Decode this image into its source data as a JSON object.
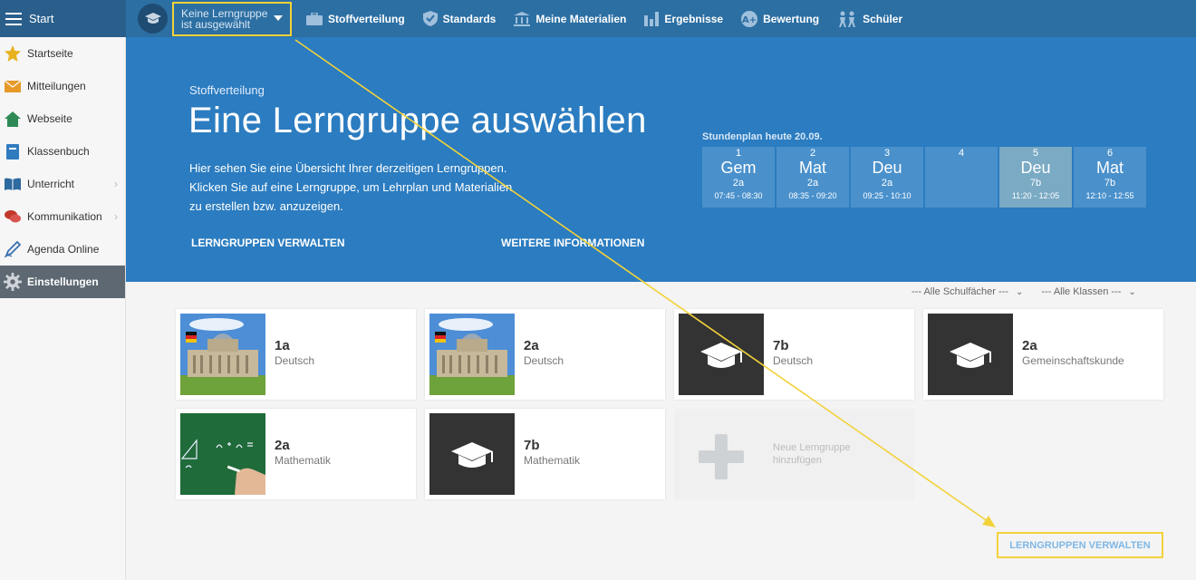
{
  "topbar": {
    "start_label": "Start",
    "group_select": {
      "line1": "Keine Lerngruppe",
      "line2": "ist ausgewählt"
    },
    "nav": [
      {
        "label": "Stoffverteilung",
        "icon": "briefcase-icon"
      },
      {
        "label": "Standards",
        "icon": "shield-icon"
      },
      {
        "label": "Meine Materialien",
        "icon": "library-icon"
      },
      {
        "label": "Ergebnisse",
        "icon": "bar-chart-icon"
      },
      {
        "label": "Bewertung",
        "icon": "grading-icon"
      },
      {
        "label": "Schüler",
        "icon": "students-icon"
      }
    ]
  },
  "sidebar": {
    "items": [
      {
        "label": "Startseite",
        "icon": "star-icon"
      },
      {
        "label": "Mitteilungen",
        "icon": "envelope-icon"
      },
      {
        "label": "Webseite",
        "icon": "home-icon"
      },
      {
        "label": "Klassenbuch",
        "icon": "notebook-icon"
      },
      {
        "label": "Unterricht",
        "icon": "book-icon"
      },
      {
        "label": "Kommunikation",
        "icon": "chat-icon"
      },
      {
        "label": "Agenda Online",
        "icon": "pen-icon"
      },
      {
        "label": "Einstellungen",
        "icon": "gear-icon"
      }
    ]
  },
  "hero": {
    "kicker": "Stoffverteilung",
    "title": "Eine Lerngruppe auswählen",
    "desc1": "Hier sehen Sie eine Übersicht Ihrer derzeitigen Lerngruppen.",
    "desc2": "Klicken Sie auf eine Lerngruppe, um Lehrplan und Materialien",
    "desc3": "zu erstellen bzw. anzuzeigen.",
    "link_manage": "LERNGRUPPEN VERWALTEN",
    "link_info": "WEITERE INFORMATIONEN"
  },
  "schedule": {
    "title": "Stundenplan heute 20.09.",
    "slots": [
      {
        "num": "1",
        "subject": "Gem",
        "class": "2a",
        "time": "07:45 - 08:30"
      },
      {
        "num": "2",
        "subject": "Mat",
        "class": "2a",
        "time": "08:35 - 09:20"
      },
      {
        "num": "3",
        "subject": "Deu",
        "class": "2a",
        "time": "09:25 - 10:10"
      },
      {
        "num": "4",
        "subject": "",
        "class": "",
        "time": ""
      },
      {
        "num": "5",
        "subject": "Deu",
        "class": "7b",
        "time": "11:20 - 12:05"
      },
      {
        "num": "6",
        "subject": "Mat",
        "class": "7b",
        "time": "12:10 - 12:55"
      }
    ]
  },
  "filters": {
    "subjects": "--- Alle Schulfächer ---",
    "classes": "--- Alle Klassen ---"
  },
  "cards": [
    {
      "class": "1a",
      "subject": "Deutsch"
    },
    {
      "class": "2a",
      "subject": "Deutsch"
    },
    {
      "class": "7b",
      "subject": "Deutsch"
    },
    {
      "class": "2a",
      "subject": "Gemeinschaftskunde"
    },
    {
      "class": "2a",
      "subject": "Mathematik"
    },
    {
      "class": "7b",
      "subject": "Mathematik"
    }
  ],
  "add_card": {
    "line1": "Neue Lerngruppe",
    "line2": "hinzufügen"
  },
  "bottom_link": "LERNGRUPPEN VERWALTEN",
  "colors": {
    "topbar": "#2c6fa3",
    "hero": "#2b7cc0",
    "highlight": "#f2d23a",
    "active_sidebar": "#5d6872"
  }
}
